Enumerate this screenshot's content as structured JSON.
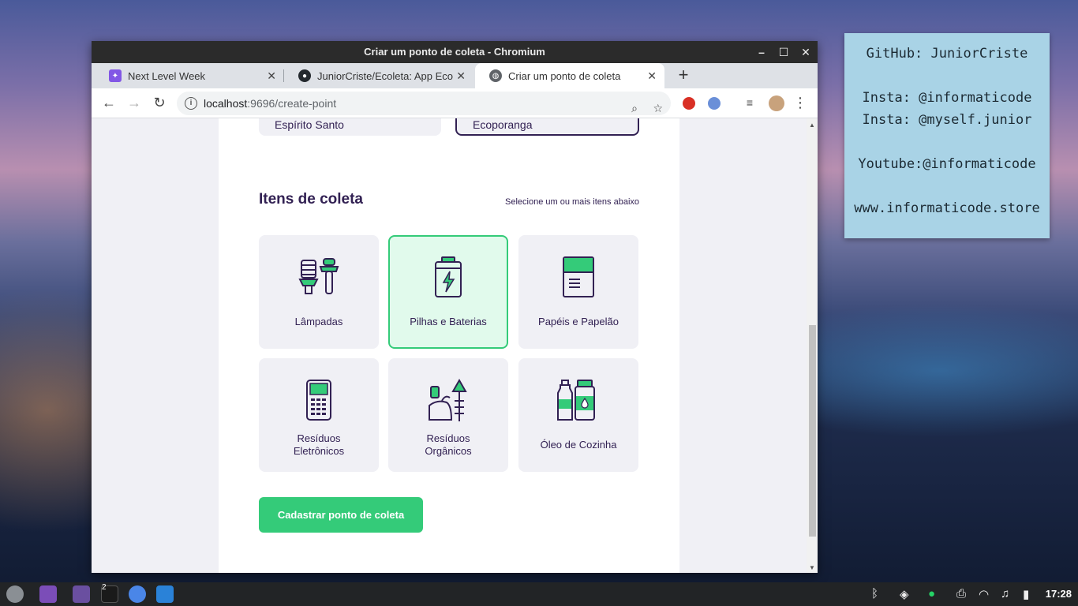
{
  "desktop": {
    "sign_lines": [
      "GitHub: JuniorCriste",
      "Insta: @informaticode",
      "Insta: @myself.junior",
      "Youtube:@informaticode",
      "www.informaticode.store"
    ]
  },
  "window": {
    "title": "Criar um ponto de coleta - Chromium",
    "tabs": [
      {
        "label": "Next Level Week"
      },
      {
        "label": "JuniorCriste/Ecoleta: App Eco"
      },
      {
        "label": "Criar um ponto de coleta"
      }
    ],
    "url_host": "localhost",
    "url_rest": ":9696/create-point"
  },
  "form": {
    "state_value": "Espírito Santo",
    "city_value": "Ecoporanga",
    "items_title": "Itens de coleta",
    "items_hint": "Selecione um ou mais itens abaixo",
    "items": [
      {
        "label": "Lâmpadas",
        "selected": false
      },
      {
        "label": "Pilhas e Baterias",
        "selected": true
      },
      {
        "label": "Papéis e Papelão",
        "selected": false
      },
      {
        "label_line1": "Resíduos",
        "label_line2": "Eletrônicos",
        "selected": false
      },
      {
        "label_line1": "Resíduos",
        "label_line2": "Orgânicos",
        "selected": false
      },
      {
        "label": "Óleo de Cozinha",
        "selected": false
      }
    ],
    "submit_label": "Cadastrar ponto de coleta"
  },
  "taskbar": {
    "terminal_badge": "2",
    "clock": "17:28"
  },
  "colors": {
    "primary": "#34cb79",
    "title": "#322153",
    "card_bg": "#f0f0f5",
    "selected_bg": "#e1faec"
  }
}
